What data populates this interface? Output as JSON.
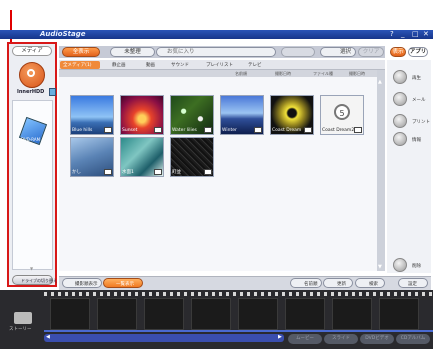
{
  "app": {
    "title": "AudioStage",
    "window_controls": [
      "?",
      "_",
      "□",
      "✕"
    ]
  },
  "sidebar": {
    "tab_label": "メディア",
    "inner_hdd_label": "InnerHDD",
    "disc_label": "DVD-RAM",
    "bottom_label": "ドライブの切り替え"
  },
  "toolbar": {
    "show_all": "全表示",
    "unorganized": "未整理",
    "favorites": "お気に入り",
    "select": "選択",
    "clear": "クリア",
    "sort_mode": "表示",
    "apps": "アプリ"
  },
  "filter": {
    "items": [
      "全メディア(1)",
      "静止画",
      "動画",
      "サウンド",
      "プレイリスト",
      "テレビ"
    ]
  },
  "columns": [
    "名前順",
    "撮影日時",
    "ファイル種",
    "撮影日時"
  ],
  "thumbnails": [
    {
      "caption": "Blue hills"
    },
    {
      "caption": "Sunset"
    },
    {
      "caption": "Water lilies"
    },
    {
      "caption": "Winter"
    },
    {
      "caption": "Coast Dream"
    },
    {
      "caption": "Coast Dream2"
    },
    {
      "caption": "かし"
    },
    {
      "caption": "水面1"
    },
    {
      "caption": "町並"
    }
  ],
  "right_panel": [
    "再生",
    "メール",
    "プリント",
    "情報",
    "削除"
  ],
  "bottom_bar": {
    "left": "撮影順表示",
    "middle": "一覧表示",
    "sort": "名前順",
    "refresh": "更新",
    "search": "検索",
    "settings": "設定"
  },
  "storyboard": {
    "label": "ストーリー",
    "buttons": [
      "ムービー",
      "スライド",
      "DVDビデオ",
      "CDアルバム"
    ]
  }
}
